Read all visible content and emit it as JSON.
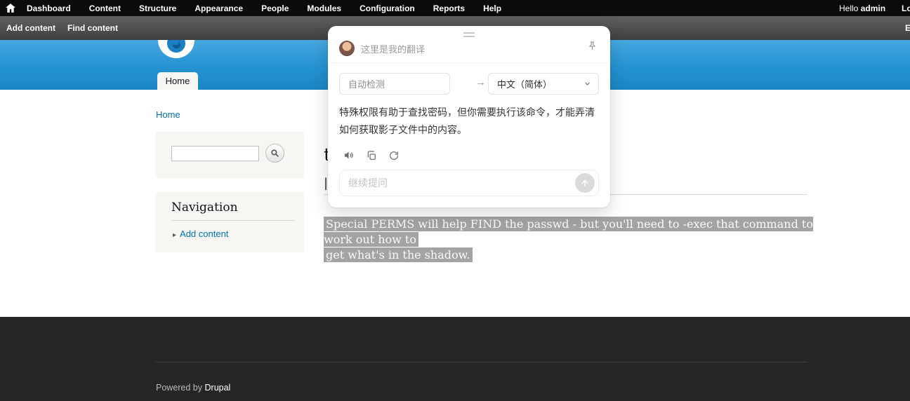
{
  "admin_toolbar": {
    "items": [
      "Dashboard",
      "Content",
      "Structure",
      "Appearance",
      "People",
      "Modules",
      "Configuration",
      "Reports",
      "Help"
    ],
    "greeting": "Hello",
    "username": "admin",
    "logout": "Log out"
  },
  "shortcut_bar": {
    "add_content": "Add content",
    "find_content": "Find content",
    "edit_shortcuts": "Edit shortcuts"
  },
  "header": {
    "home_tab": "Home"
  },
  "breadcrumb": {
    "home": "Home"
  },
  "sidebar": {
    "navigation_title": "Navigation",
    "nav_bullet": "▸",
    "nav_add_content": "Add content"
  },
  "content": {
    "title_fragment": "t",
    "body_fragment": "|",
    "selected_line1": "Special PERMS will help FIND the passwd - but you'll need to -exec that command to work out how to",
    "selected_line2": "get what's in the shadow."
  },
  "translator": {
    "title": "这里是我的翻译",
    "source_lang": "自动检测",
    "arrow": "→",
    "target_lang": "中文（简体）",
    "translation": "特殊权限有助于查找密码，但你需要执行该命令，才能弄清如何获取影子文件中的内容。",
    "input_placeholder": "继续提问"
  },
  "footer": {
    "powered_by": "Powered by",
    "drupal": "Drupal"
  },
  "colors": {
    "header_blue": "#2493d2",
    "link_blue": "#0071b3",
    "selection_gray": "#a3a3a3"
  }
}
